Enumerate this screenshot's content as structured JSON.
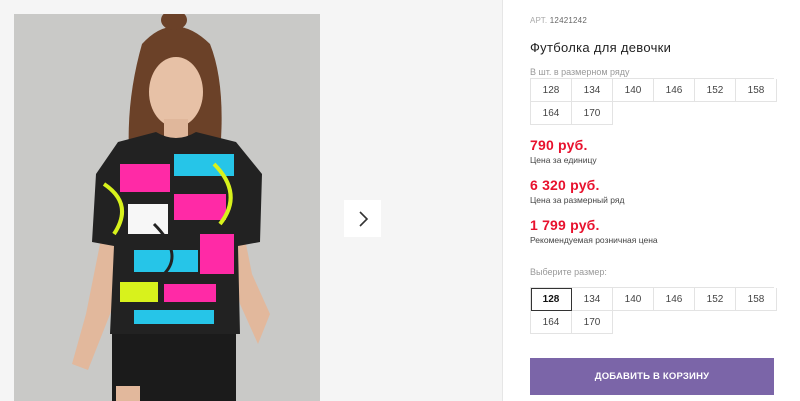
{
  "product": {
    "article_label": "АРТ.",
    "article_number": "12421242",
    "title": "Футболка для девочки"
  },
  "pack_sizes": {
    "label": "В шт. в размерном ряду",
    "sizes": [
      "128",
      "134",
      "140",
      "146",
      "152",
      "158",
      "164",
      "170"
    ]
  },
  "prices": [
    {
      "value": "790 руб.",
      "label": "Цена за единицу"
    },
    {
      "value": "6 320 руб.",
      "label": "Цена за размерный ряд"
    },
    {
      "value": "1 799 руб.",
      "label": "Рекомендуемая розничная цена"
    }
  ],
  "size_picker": {
    "label": "Выберите размер:",
    "sizes": [
      "128",
      "134",
      "140",
      "146",
      "152",
      "158",
      "164",
      "170"
    ],
    "selected": "128"
  },
  "cart_button": {
    "label": "ДОБАВИТЬ В КОРЗИНУ"
  },
  "gallery": {
    "next_icon": "chevron-right-icon"
  },
  "colors": {
    "price": "#e8112d",
    "button": "#7b65a8",
    "image_bg": "#c9c9c7"
  }
}
